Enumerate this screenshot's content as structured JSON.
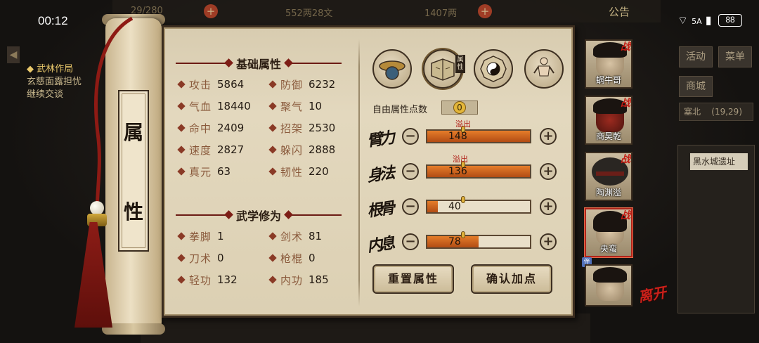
{
  "status_bar": {
    "time": "00:12",
    "signal": "5A",
    "battery": "88",
    "time_right": "00:12"
  },
  "top_resources": {
    "resource_a": "29/280",
    "money": "552两28文",
    "silver": "1407两",
    "notice": "公告"
  },
  "quest": {
    "title": "武林作局",
    "desc_line1": "玄慈面露担忧",
    "desc_line2": "继续交谈"
  },
  "right_menu": {
    "activity": "活动",
    "menu": "菜单",
    "shop": "商城",
    "region": "塞北",
    "coords": "(19,29)",
    "city": "黑水城遗址"
  },
  "scroll": {
    "title_char1": "属",
    "title_char2": "性"
  },
  "base_attrs": {
    "title": "基础属性",
    "items": [
      {
        "label": "攻击",
        "value": "5864"
      },
      {
        "label": "防御",
        "value": "6232"
      },
      {
        "label": "气血",
        "value": "18440"
      },
      {
        "label": "聚气",
        "value": "10"
      },
      {
        "label": "命中",
        "value": "2409"
      },
      {
        "label": "招架",
        "value": "2530"
      },
      {
        "label": "速度",
        "value": "2827"
      },
      {
        "label": "躲闪",
        "value": "2888"
      },
      {
        "label": "真元",
        "value": "63"
      },
      {
        "label": "韧性",
        "value": "220"
      }
    ]
  },
  "martial": {
    "title": "武学修为",
    "items": [
      {
        "label": "拳脚",
        "value": "1"
      },
      {
        "label": "剑术",
        "value": "81"
      },
      {
        "label": "刀术",
        "value": "0"
      },
      {
        "label": "枪棍",
        "value": "0"
      },
      {
        "label": "轻功",
        "value": "132"
      },
      {
        "label": "内功",
        "value": "185"
      }
    ]
  },
  "tabs": {
    "icons": [
      "hat-icon",
      "book-icon",
      "taiji-icon",
      "meridian-figure-icon"
    ],
    "active_tag": "属性"
  },
  "free_points": {
    "label": "自由属性点数",
    "value": "0"
  },
  "attributes": [
    {
      "name": "臂力",
      "value": "148",
      "fill_percent": 100,
      "overflow": "溢出"
    },
    {
      "name": "身法",
      "value": "136",
      "fill_percent": 100,
      "overflow": "溢出"
    },
    {
      "name": "根骨",
      "value": "40",
      "fill_percent": 10
    },
    {
      "name": "内息",
      "value": "78",
      "fill_percent": 50
    }
  ],
  "buttons": {
    "reset": "重置属性",
    "confirm": "确认加点"
  },
  "party": [
    {
      "name": "蜗牛哥",
      "tag": "战"
    },
    {
      "name": "商昊乾",
      "tag": "战"
    },
    {
      "name": "陶渊溢",
      "tag": "战"
    },
    {
      "name": "央蛮",
      "tag": "战"
    },
    {
      "name": ""
    }
  ],
  "party_selected_tag": "伴",
  "leave_label": "离开",
  "colors": {
    "overflow_red": "#b01c14",
    "bar_orange": "#e57d2a",
    "accent_red": "#c41d14"
  }
}
